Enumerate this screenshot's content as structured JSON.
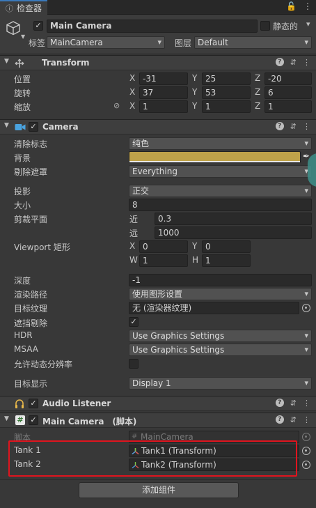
{
  "tab": {
    "label": "检查器"
  },
  "object": {
    "name": "Main Camera",
    "static_label": "静态的",
    "tag_label": "标签",
    "tag_value": "MainCamera",
    "layer_label": "图层",
    "layer_value": "Default"
  },
  "transform": {
    "title": "Transform",
    "position_label": "位置",
    "rotation_label": "旋转",
    "scale_label": "缩放",
    "axes": {
      "x": "X",
      "y": "Y",
      "z": "Z"
    },
    "position": {
      "x": "-31",
      "y": "25",
      "z": "-20"
    },
    "rotation": {
      "x": "37",
      "y": "53",
      "z": "6"
    },
    "scale": {
      "x": "1",
      "y": "1",
      "z": "1"
    }
  },
  "camera": {
    "title": "Camera",
    "clear_flags_label": "清除标志",
    "clear_flags_value": "纯色",
    "background_label": "背景",
    "background_color": "#bfa24a",
    "culling_mask_label": "剔除遮罩",
    "culling_mask_value": "Everything",
    "projection_label": "投影",
    "projection_value": "正交",
    "size_label": "大小",
    "size_value": "8",
    "clipping_label": "剪裁平面",
    "near_label": "近",
    "near_value": "0.3",
    "far_label": "远",
    "far_value": "1000",
    "viewport_label": "Viewport 矩形",
    "viewport": {
      "x_label": "X",
      "x": "0",
      "y_label": "Y",
      "y": "0",
      "w_label": "W",
      "w": "1",
      "h_label": "H",
      "h": "1"
    },
    "depth_label": "深度",
    "depth_value": "-1",
    "render_path_label": "渲染路径",
    "render_path_value": "使用图形设置",
    "target_texture_label": "目标纹理",
    "target_texture_value": "无 (渲染器纹理)",
    "occlusion_label": "遮挡剔除",
    "hdr_label": "HDR",
    "hdr_value": "Use Graphics Settings",
    "msaa_label": "MSAA",
    "msaa_value": "Use Graphics Settings",
    "dynamic_res_label": "允许动态分辨率",
    "target_display_label": "目标显示",
    "target_display_value": "Display 1"
  },
  "audio_listener": {
    "title": "Audio Listener"
  },
  "script": {
    "title": "Main Camera　(脚本)",
    "script_label": "脚本",
    "script_value": "MainCamera",
    "tank1_label": "Tank 1",
    "tank1_value": "Tank1 (Transform)",
    "tank2_label": "Tank 2",
    "tank2_value": "Tank2 (Transform)"
  },
  "add_component_label": "添加组件",
  "highlight_color": "#e0141e"
}
